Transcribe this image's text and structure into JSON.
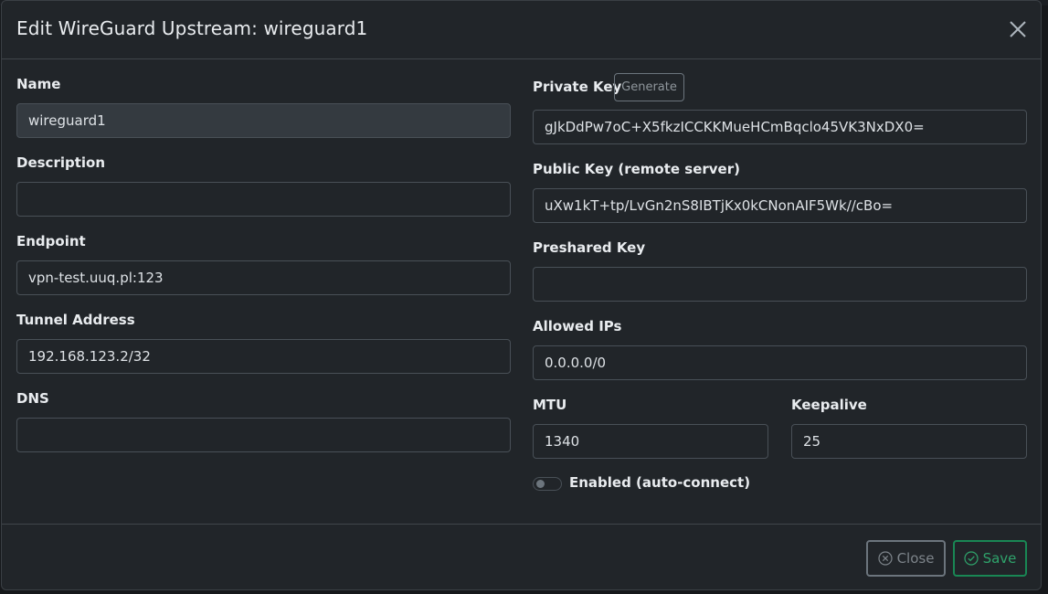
{
  "modal": {
    "title": "Edit WireGuard Upstream: wireguard1",
    "close_icon": "close-icon"
  },
  "form": {
    "name": {
      "label": "Name",
      "value": "wireguard1"
    },
    "description": {
      "label": "Description",
      "value": ""
    },
    "endpoint": {
      "label": "Endpoint",
      "value": "vpn-test.uuq.pl:123"
    },
    "tunnel_address": {
      "label": "Tunnel Address",
      "value": "192.168.123.2/32"
    },
    "dns": {
      "label": "DNS",
      "value": ""
    },
    "private_key": {
      "label": "Private Key",
      "generate_label": "Generate",
      "value": "gJkDdPw7oC+X5fkzICCKKMueHCmBqclo45VK3NxDX0="
    },
    "public_key": {
      "label": "Public Key (remote server)",
      "value": "uXw1kT+tp/LvGn2nS8IBTjKx0kCNonAIF5Wk//cBo="
    },
    "preshared_key": {
      "label": "Preshared Key",
      "value": ""
    },
    "allowed_ips": {
      "label": "Allowed IPs",
      "value": "0.0.0.0/0"
    },
    "mtu": {
      "label": "MTU",
      "value": "1340"
    },
    "keepalive": {
      "label": "Keepalive",
      "value": "25"
    },
    "enabled": {
      "label": "Enabled (auto-connect)",
      "checked": false
    }
  },
  "footer": {
    "close_label": "Close",
    "save_label": "Save"
  },
  "colors": {
    "background": "#212529",
    "border": "#495057",
    "save_accent": "#198754",
    "close_accent": "#6c757d"
  }
}
